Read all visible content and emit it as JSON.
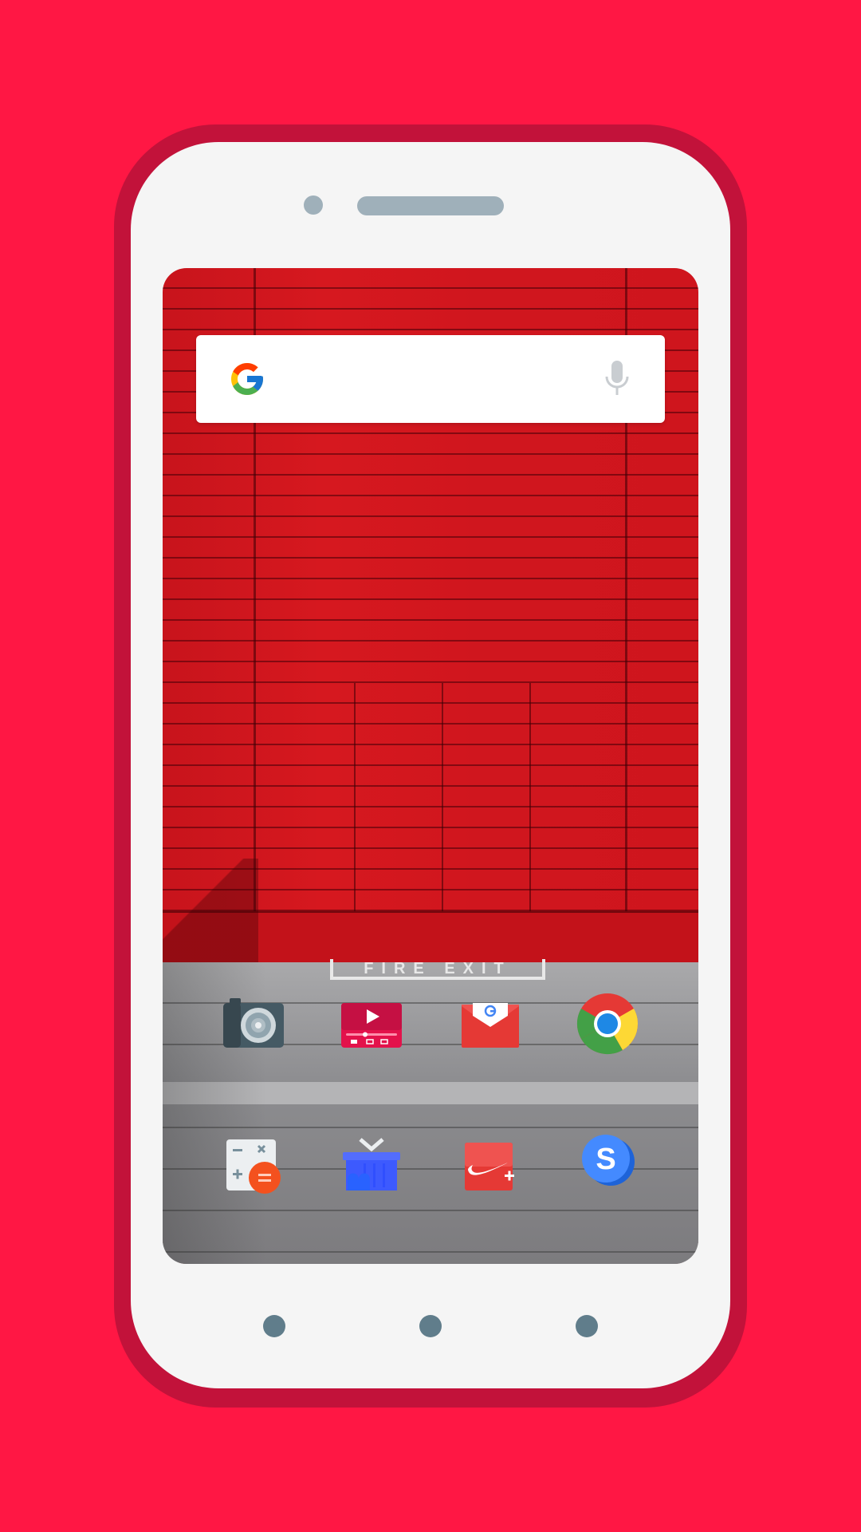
{
  "wallpaper": {
    "floor_text": "FIRE EXIT"
  },
  "search": {
    "logo_icon": "google-g-icon",
    "mic_icon": "microphone-icon"
  },
  "apps_row1": [
    {
      "name": "camera",
      "icon": "camera-icon"
    },
    {
      "name": "video-player",
      "icon": "video-player-icon"
    },
    {
      "name": "gmail",
      "icon": "gmail-icon"
    },
    {
      "name": "chrome",
      "icon": "chrome-icon"
    }
  ],
  "apps_row2": [
    {
      "name": "calculator",
      "icon": "calculator-icon"
    },
    {
      "name": "shopping",
      "icon": "shopping-basket-icon"
    },
    {
      "name": "nike-plus",
      "icon": "nike-plus-icon"
    },
    {
      "name": "skype",
      "icon": "skype-icon"
    }
  ],
  "nav_buttons": [
    "back",
    "home",
    "recents"
  ],
  "colors": {
    "background": "#ff1744",
    "phone_body": "#f5f5f5",
    "nav_dot": "#607d8b"
  }
}
